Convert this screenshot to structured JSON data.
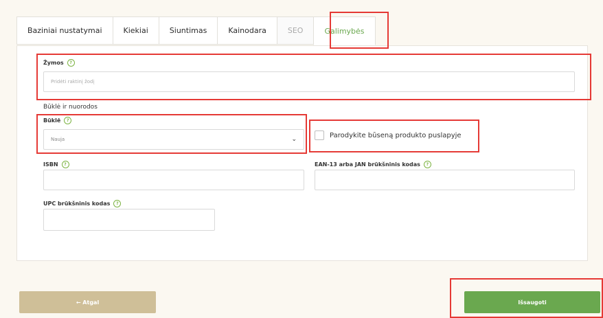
{
  "tabs": [
    {
      "label": "Baziniai nustatymai"
    },
    {
      "label": "Kiekiai"
    },
    {
      "label": "Siuntimas"
    },
    {
      "label": "Kainodara"
    },
    {
      "label": "SEO"
    },
    {
      "label": "Galimybės"
    }
  ],
  "tags": {
    "label": "Žymos",
    "placeholder": "Pridėti raktinį žodį"
  },
  "section_title": "Būklė ir nuorodos",
  "condition": {
    "label": "Būklė",
    "value": "Nauja"
  },
  "show_condition": {
    "label": "Parodykite būseną produkto puslapyje"
  },
  "isbn": {
    "label": "ISBN"
  },
  "ean": {
    "label": "EAN-13 arba JAN brūkšninis kodas"
  },
  "upc": {
    "label": "UPC brūkšninis kodas"
  },
  "buttons": {
    "back": "← Atgal",
    "save": "Išsaugoti"
  },
  "colors": {
    "accent": "#6aa84f",
    "back_button": "#cfbf98",
    "highlight": "#e53935"
  },
  "icons": {
    "help": "question-circle-icon",
    "dropdown": "chevron-down-icon",
    "back": "arrow-left-icon"
  }
}
